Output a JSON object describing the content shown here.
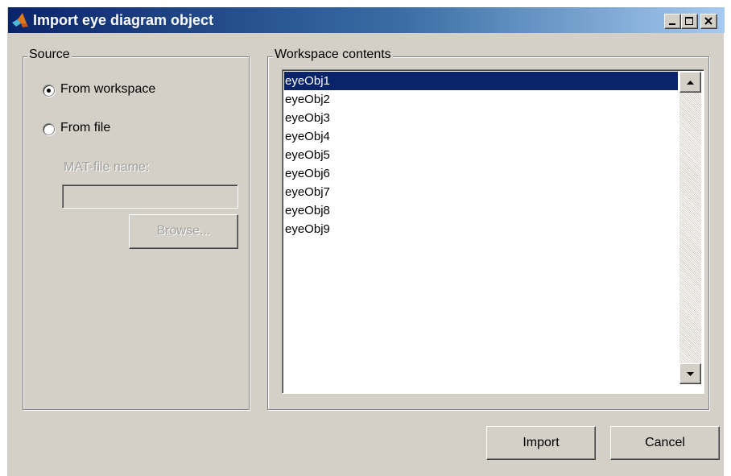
{
  "window": {
    "title": "Import eye diagram object",
    "controls": {
      "minimize_icon": "minimize-icon",
      "maximize_icon": "maximize-icon",
      "close_icon": "close-icon"
    }
  },
  "source": {
    "legend": "Source",
    "options": [
      {
        "label": "From workspace",
        "selected": true
      },
      {
        "label": "From file",
        "selected": false
      }
    ],
    "mat_file_label": "MAT-file name:",
    "mat_file_value": "",
    "browse_label": "Browse..."
  },
  "workspace": {
    "legend": "Workspace contents",
    "items": [
      "eyeObj1",
      "eyeObj2",
      "eyeObj3",
      "eyeObj4",
      "eyeObj5",
      "eyeObj6",
      "eyeObj7",
      "eyeObj8",
      "eyeObj9"
    ],
    "selected_index": 0
  },
  "buttons": {
    "import_label": "Import",
    "cancel_label": "Cancel"
  },
  "colors": {
    "title_bar_start": "#0a246a",
    "title_bar_end": "#a6caf0",
    "selection": "#0a246a",
    "face": "#d4d0c8"
  }
}
